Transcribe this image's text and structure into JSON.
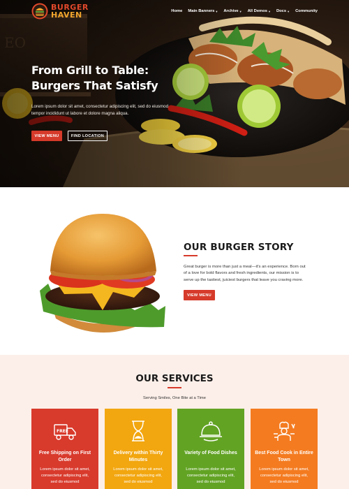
{
  "brand": {
    "line1": "BURGER",
    "line2": "HAVEN"
  },
  "nav": [
    {
      "label": "Home",
      "dropdown": false
    },
    {
      "label": "Main Banners",
      "dropdown": true
    },
    {
      "label": "Archive",
      "dropdown": true
    },
    {
      "label": "All Demos",
      "dropdown": true
    },
    {
      "label": "Docs",
      "dropdown": true
    },
    {
      "label": "Community",
      "dropdown": false
    }
  ],
  "hero": {
    "title": "From Grill to Table: Burgers That Satisfy",
    "subtitle": "Lorem ipsum dolor sit amet, consectetur adipiscing elit, sed do eiusmod tempor incididunt ut labore et dolore magna aliqua.",
    "primary_button": "VIEW MENU",
    "secondary_button": "FIND LOCATION"
  },
  "story": {
    "title": "OUR BURGER STORY",
    "text": "Great burger is more than just a meal—it's an experience. Born out of a love for bold flavors and fresh ingredients, our mission is to serve up the tastiest, juiciest burgers that leave you craving more.",
    "button": "VIEW MENU"
  },
  "services": {
    "title": "OUR SERVICES",
    "tagline": "Serving Smiles, One Bite at a Time",
    "cards": [
      {
        "title": "Free Shipping on First Order",
        "text": "Lorem ipsum dolor sit amet, consectetur adipiscing elit, sed do eiusmod",
        "icon": "free-delivery-truck-icon",
        "color": "#d83a2c"
      },
      {
        "title": "Delivery within Thirty Minutes",
        "text": "Lorem ipsum dolor sit amet, consectetur adipiscing elit, sed do eiusmod",
        "icon": "hourglass-icon",
        "color": "#f2a60f"
      },
      {
        "title": "Variety of Food Dishes",
        "text": "Lorem ipsum dolor sit amet, consectetur adipiscing elit, sed do eiusmod",
        "icon": "food-cloche-icon",
        "color": "#62a324"
      },
      {
        "title": "Best Food Cook in Entire Town",
        "text": "Lorem ipsum dolor sit amet, consectetur adipiscing elit, sed do eiusmod",
        "icon": "chef-icon",
        "color": "#f47b20"
      }
    ]
  },
  "colors": {
    "accent": "#d63a2a",
    "services_bg": "#fcefe9",
    "brand_orange": "#f0a52c"
  }
}
